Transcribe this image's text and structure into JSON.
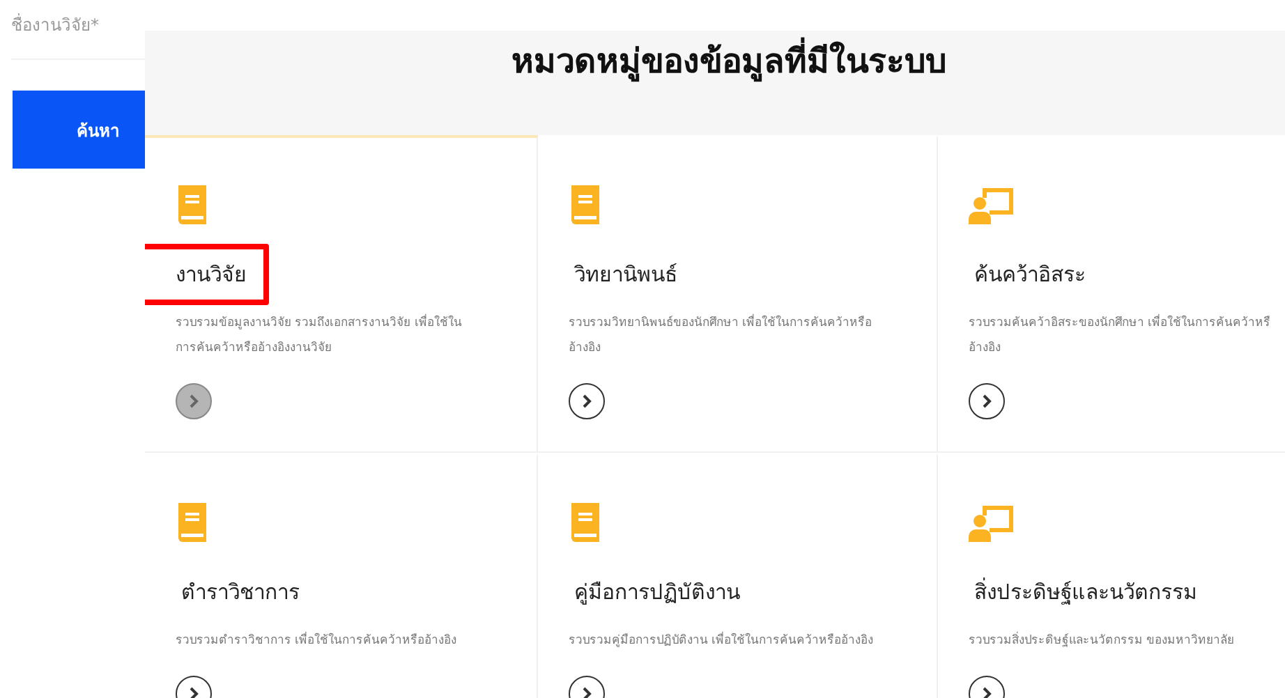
{
  "search_form": {
    "field_label": "ชื่องานวิจัย*",
    "button": "ค้นหา"
  },
  "section": {
    "title": "หมวดหมู่ของข้อมูลที่มีในระบบ"
  },
  "categories": [
    {
      "kind": "book",
      "title": "งานวิจัย",
      "description": [
        "รวบรวมข้อมูลงานวิจัย รวมถึงเอกสารงานวิจัย เพื่อใช้ใน",
        "การค้นคว้าหรืออ้างอิงงานวิจัย"
      ],
      "highlighted": true,
      "active": true
    },
    {
      "kind": "book",
      "title": "วิทยานิพนธ์",
      "description": [
        "รวบรวมวิทยานิพนธ์ของนักศึกษา เพื่อใช้ในการค้นคว้าหรือ",
        "อ้างอิง"
      ],
      "highlighted": false,
      "active": false
    },
    {
      "kind": "presenter",
      "title": "ค้นคว้าอิสระ",
      "description": [
        "รวบรวมค้นคว้าอิสระของนักศึกษา เพื่อใช้ในการค้นคว้าหรื",
        "อ้างอิง"
      ],
      "highlighted": false,
      "active": false
    },
    {
      "kind": "book",
      "title": "ตำราวิชาการ",
      "description": [
        "รวบรวมตำราวิชาการ เพื่อใช้ในการค้นคว้าหรืออ้างอิง"
      ],
      "highlighted": false,
      "active": false
    },
    {
      "kind": "book",
      "title": "คู่มือการปฏิบัติงาน",
      "description": [
        "รวบรวมคู่มือการปฏิบัติงาน เพื่อใช้ในการค้นคว้าหรืออ้างอิง"
      ],
      "highlighted": false,
      "active": false
    },
    {
      "kind": "presenter",
      "title": "สิ่งประดิษฐ์และนวัตกรรม",
      "description": [
        "รวบรวมสิ่งประดิษฐ์และนวัตกรรม ของมหาวิทยาลัย"
      ],
      "highlighted": false,
      "active": false
    }
  ]
}
